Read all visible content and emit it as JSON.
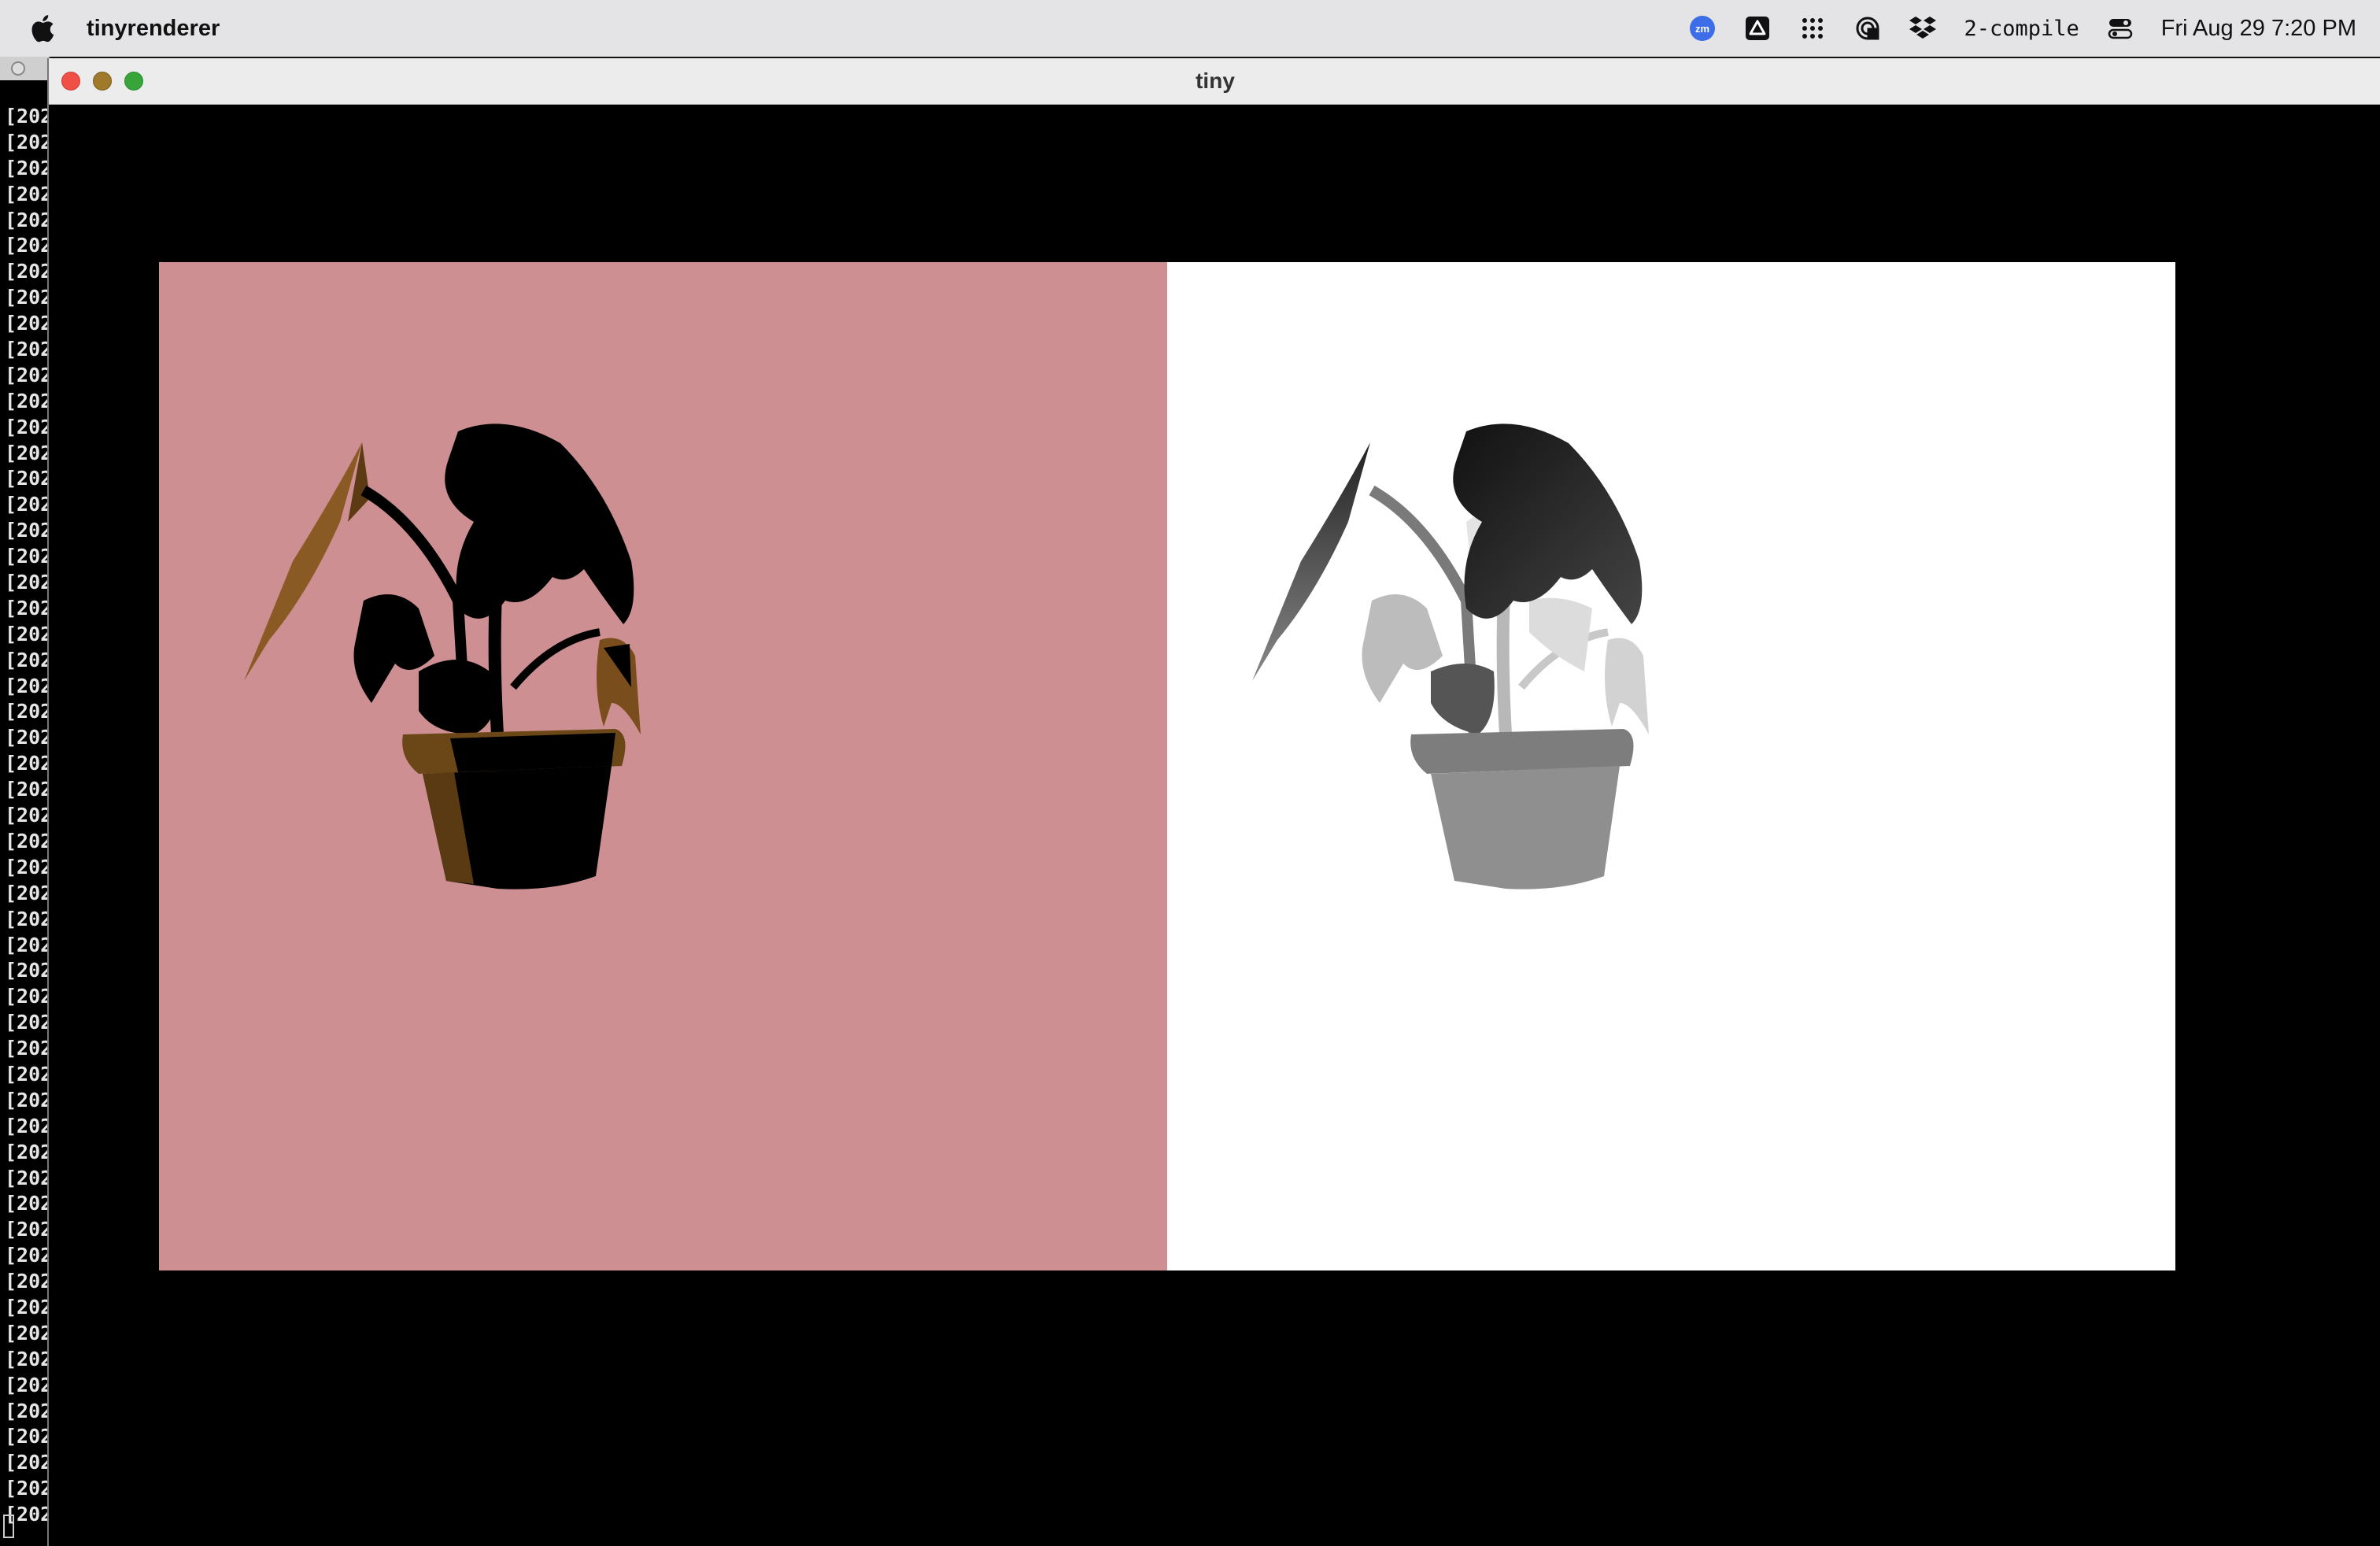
{
  "menubar": {
    "app_name": "tinyrenderer",
    "status_label": "2-compile",
    "datetime": "Fri Aug 29  7:20 PM",
    "icons": [
      "apple-icon",
      "zoom-icon",
      "drive-icon",
      "grid-dots-icon",
      "screen-share-icon",
      "dropbox-icon",
      "control-center-icon"
    ]
  },
  "window": {
    "title": "tiny"
  },
  "terminal": {
    "line_text": "[202"
  },
  "colors": {
    "shaded_background": "#cd8f91",
    "depth_background": "#ffffff",
    "window_background": "#000000"
  }
}
